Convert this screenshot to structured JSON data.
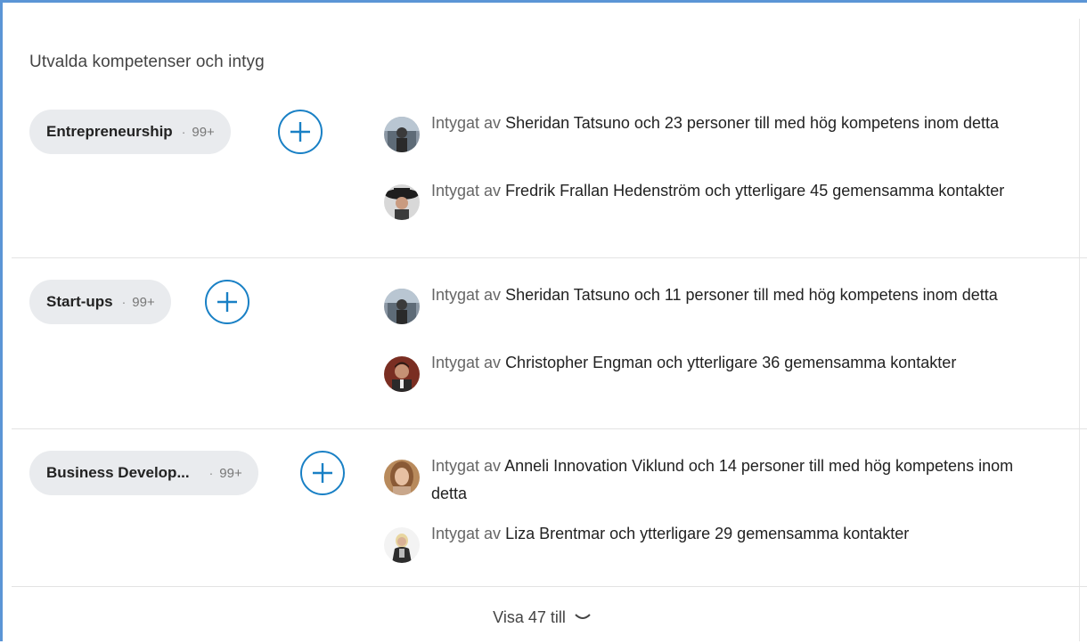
{
  "section": {
    "title": "Utvalda kompetenser och intyg"
  },
  "skills": [
    {
      "name": "Entrepreneurship",
      "separator": "·",
      "count": "99+",
      "endorsements": [
        {
          "prefix": "Intygat av",
          "text": "Sheridan Tatsuno och 23 personer till med hög kompetens inom detta",
          "avatar": "sheridan-avatar"
        },
        {
          "prefix": "Intygat av",
          "text": "Fredrik Frallan Hedenström och ytterligare 45 gemensamma kontakter",
          "avatar": "fredrik-avatar"
        }
      ]
    },
    {
      "name": "Start-ups",
      "separator": "·",
      "count": "99+",
      "endorsements": [
        {
          "prefix": "Intygat av",
          "text": "Sheridan Tatsuno och 11 personer till med hög kompetens inom detta",
          "avatar": "sheridan-avatar"
        },
        {
          "prefix": "Intygat av",
          "text": "Christopher Engman och ytterligare 36 gemensamma kontakter",
          "avatar": "christopher-avatar"
        }
      ]
    },
    {
      "name": "Business Develop...",
      "separator": "·",
      "count": "99+",
      "endorsements": [
        {
          "prefix": "Intygat av",
          "text": "Anneli Innovation Viklund och 14 personer till med hög kompetens inom detta",
          "avatar": "anneli-avatar"
        },
        {
          "prefix": "Intygat av",
          "text": "Liza Brentmar och ytterligare 29 gemensamma kontakter",
          "avatar": "liza-avatar"
        }
      ]
    }
  ],
  "footer": {
    "show_more_label": "Visa 47 till",
    "icon": "chevron-down-icon"
  },
  "colors": {
    "accent": "#1980c5",
    "frame": "#5b95d6",
    "pill_bg": "#e9ebee"
  }
}
